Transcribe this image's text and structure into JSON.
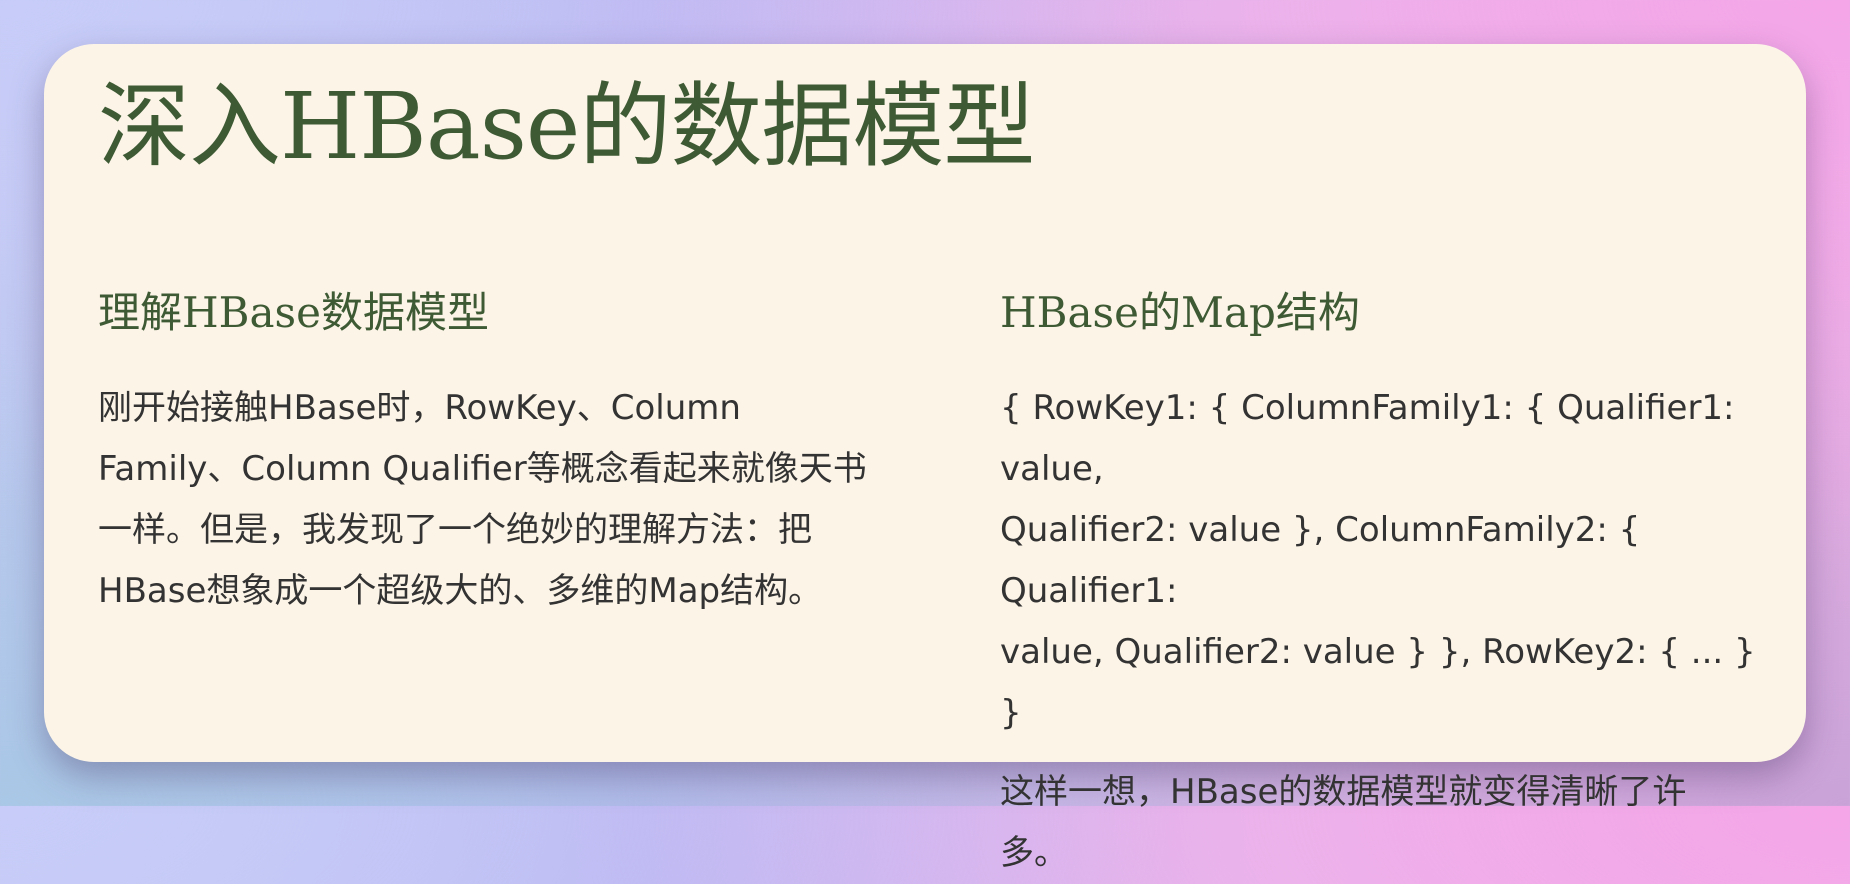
{
  "title": "深入HBase的数据模型",
  "left_section": {
    "heading": "理解HBase数据模型",
    "lines": [
      "刚开始接触HBase时，RowKey、Column",
      "Family、Column Qualifier等概念看起来就像天书",
      "一样。但是，我发现了一个绝妙的理解方法：把",
      "HBase想象成一个超级大的、多维的Map结构。"
    ]
  },
  "right_section": {
    "heading": "HBase的Map结构",
    "code_lines": [
      "{ RowKey1: { ColumnFamily1: { Qualifier1: value,",
      "Qualifier2: value }, ColumnFamily2: { Qualifier1:",
      "value, Qualifier2: value } }, RowKey2: { ... } }"
    ],
    "summary_lines": [
      "这样一想，HBase的数据模型就变得清晰了许",
      "多。"
    ]
  }
}
